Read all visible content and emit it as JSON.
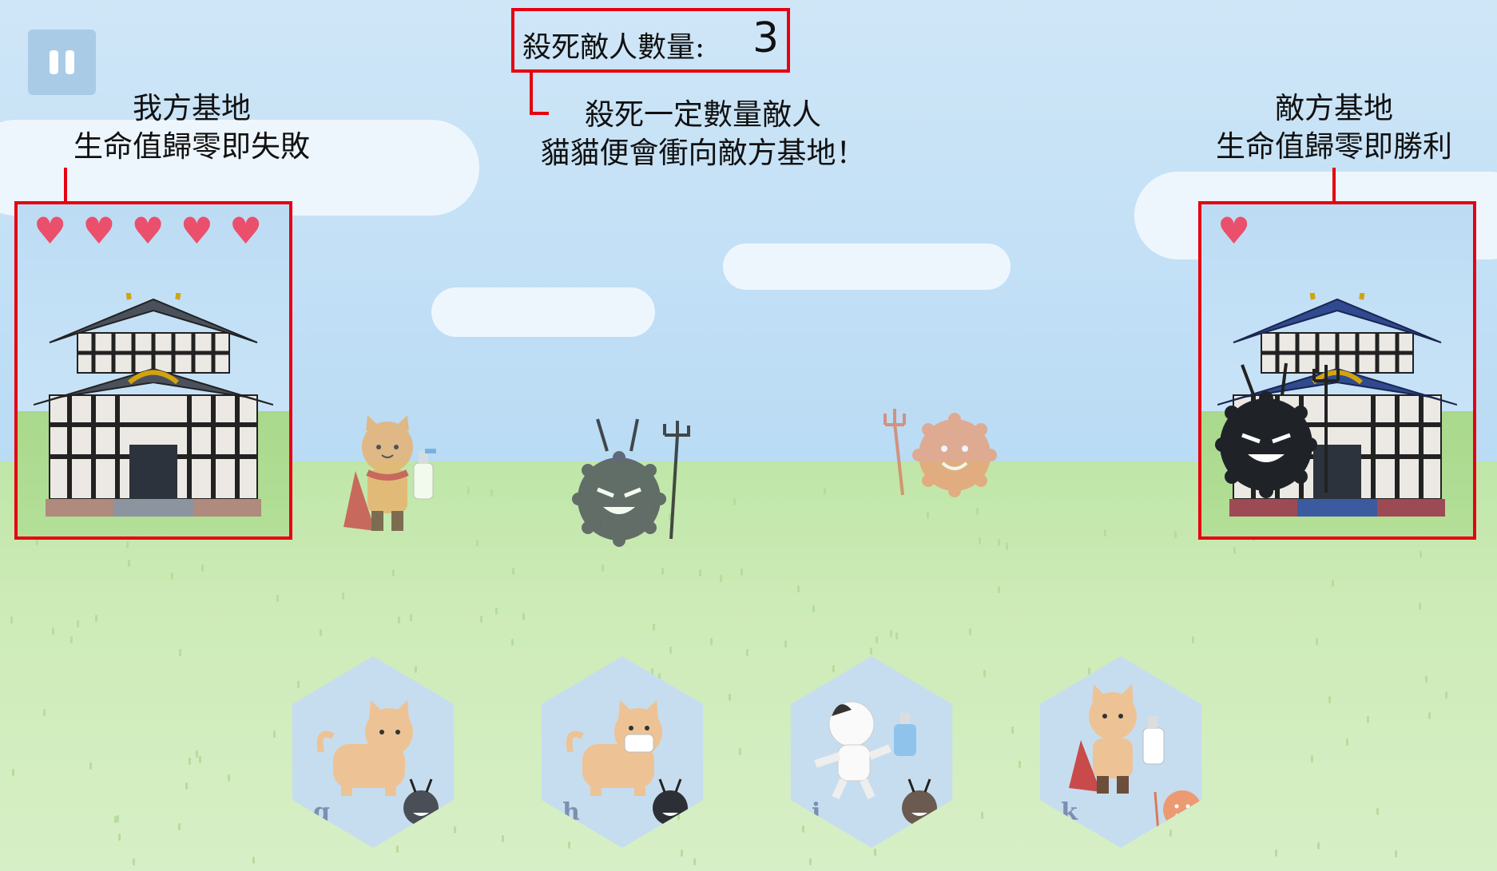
{
  "hud": {
    "pause_icon": "pause-icon",
    "kill_counter": {
      "label": "殺死敵人數量:",
      "value": "3"
    }
  },
  "annotations": {
    "player_base": [
      "我方基地",
      "生命值歸零即失敗"
    ],
    "kill_goal": [
      "殺死一定數量敵人",
      "貓貓便會衝向敵方基地！"
    ],
    "enemy_base": [
      "敵方基地",
      "生命值歸零即勝利"
    ]
  },
  "player_base": {
    "hearts": 5,
    "heart_icon": "heart-icon",
    "building": "temple-icon"
  },
  "enemy_base": {
    "hearts": 1,
    "heart_icon": "heart-icon",
    "building": "blue-temple-icon"
  },
  "field_units": [
    {
      "name": "cape-cat-with-spray-icon"
    },
    {
      "name": "gray-germ-devil-icon"
    },
    {
      "name": "orange-germ-devil-icon"
    },
    {
      "name": "dark-germ-devil-icon"
    }
  ],
  "unit_cards": [
    {
      "key": "g",
      "unit": "tabby-cat-icon",
      "counter": "gray-germ-icon"
    },
    {
      "key": "h",
      "unit": "masked-cat-icon",
      "counter": "dark-germ-icon"
    },
    {
      "key": "j",
      "unit": "white-cat-sanitizer-icon",
      "counter": "brown-germ-icon"
    },
    {
      "key": "k",
      "unit": "cape-cat-spray-icon",
      "counter": "orange-germ-icon"
    }
  ],
  "colors": {
    "highlight_red": "#e50012",
    "heart": "#ea4f6c",
    "card": "#c6ddef"
  }
}
